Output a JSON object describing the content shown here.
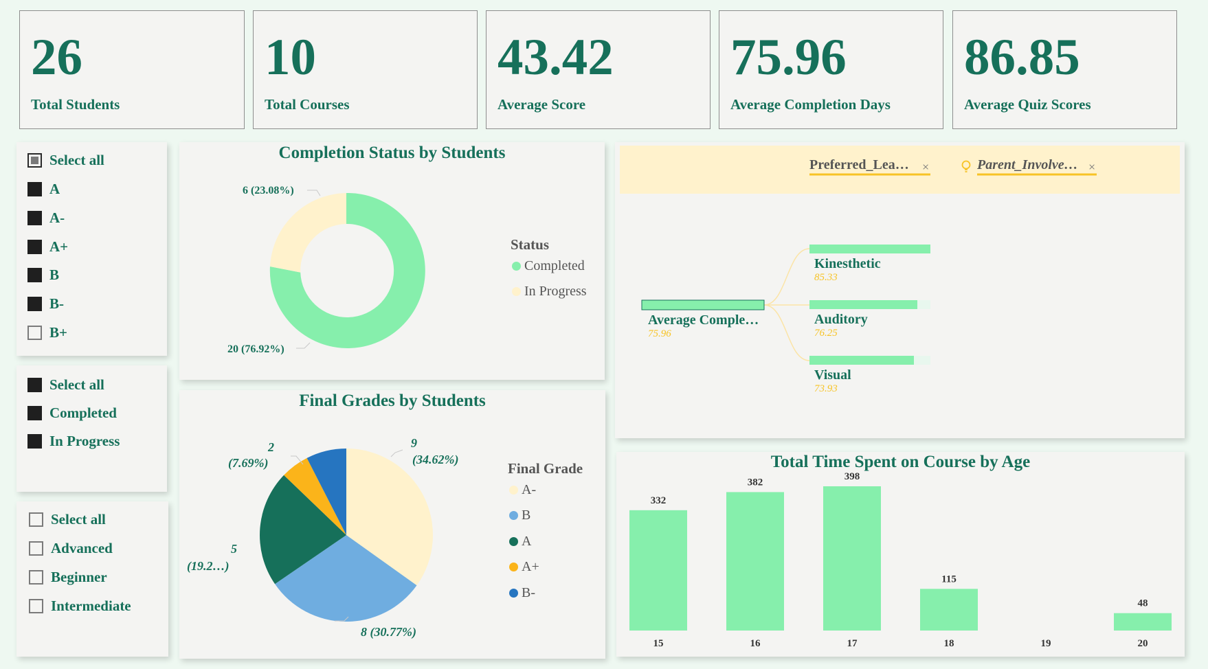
{
  "kpis": [
    {
      "value": "26",
      "label": "Total Students"
    },
    {
      "value": "10",
      "label": "Total Courses"
    },
    {
      "value": "43.42",
      "label": "Average Score"
    },
    {
      "value": "75.96",
      "label": "Average Completion Days"
    },
    {
      "value": "86.85",
      "label": "Average Quiz Scores"
    }
  ],
  "slicer_grade": {
    "items": [
      {
        "label": "Select all",
        "state": "partial"
      },
      {
        "label": "A",
        "state": "on"
      },
      {
        "label": "A-",
        "state": "on"
      },
      {
        "label": "A+",
        "state": "on"
      },
      {
        "label": "B",
        "state": "on"
      },
      {
        "label": "B-",
        "state": "on"
      },
      {
        "label": "B+",
        "state": "off"
      }
    ]
  },
  "slicer_status": {
    "items": [
      {
        "label": "Select all",
        "state": "on"
      },
      {
        "label": "Completed",
        "state": "on"
      },
      {
        "label": "In Progress",
        "state": "on"
      }
    ]
  },
  "slicer_level": {
    "items": [
      {
        "label": "Select all",
        "state": "off"
      },
      {
        "label": "Advanced",
        "state": "off"
      },
      {
        "label": "Beginner",
        "state": "off"
      },
      {
        "label": "Intermediate",
        "state": "off"
      }
    ]
  },
  "donut": {
    "title": "Completion Status by Students",
    "legend_title": "Status",
    "labels": {
      "completed": "20 (76.92%)",
      "in_progress": "6 (23.08%)"
    },
    "legend": [
      {
        "label": "Completed",
        "color": "#86efac"
      },
      {
        "label": "In Progress",
        "color": "#fff2cc"
      }
    ]
  },
  "pie": {
    "title": "Final Grades by Students",
    "legend_title": "Final Grade",
    "labels": {
      "a_minus_count": "9",
      "a_minus_pct": "(34.62%)",
      "b": "8 (30.77%)",
      "a_count": "5",
      "a_pct": "(19.2…)",
      "a_plus_count": "2",
      "a_plus_pct": "(7.69%)"
    },
    "legend": [
      {
        "label": "A-",
        "color": "#fff2cc"
      },
      {
        "label": "B",
        "color": "#6fade0"
      },
      {
        "label": "A",
        "color": "#16705a"
      },
      {
        "label": "A+",
        "color": "#fbb41a"
      },
      {
        "label": "B-",
        "color": "#2675c0"
      }
    ]
  },
  "decomp": {
    "filter1": "Preferred_Lea…",
    "filter2": "Parent_Involve…",
    "root_label": "Average Comple…",
    "root_value": "75.96",
    "nodes": [
      {
        "label": "Kinesthetic",
        "value": "85.33"
      },
      {
        "label": "Auditory",
        "value": "76.25"
      },
      {
        "label": "Visual",
        "value": "73.93"
      }
    ]
  },
  "chart_data": {
    "type": "bar",
    "title": "Total Time Spent on Course by Age",
    "categories": [
      "15",
      "16",
      "17",
      "18",
      "19",
      "20"
    ],
    "values": [
      332,
      382,
      398,
      115,
      0,
      48
    ],
    "value_labels": [
      "332",
      "382",
      "398",
      "115",
      "",
      "48"
    ],
    "color": "#86efac",
    "xlabel": "",
    "ylabel": "",
    "grid": false
  },
  "colors": {
    "accent": "#16705a",
    "green": "#86efac",
    "yellow": "#f7c325",
    "panel": "#f4f4f2"
  }
}
